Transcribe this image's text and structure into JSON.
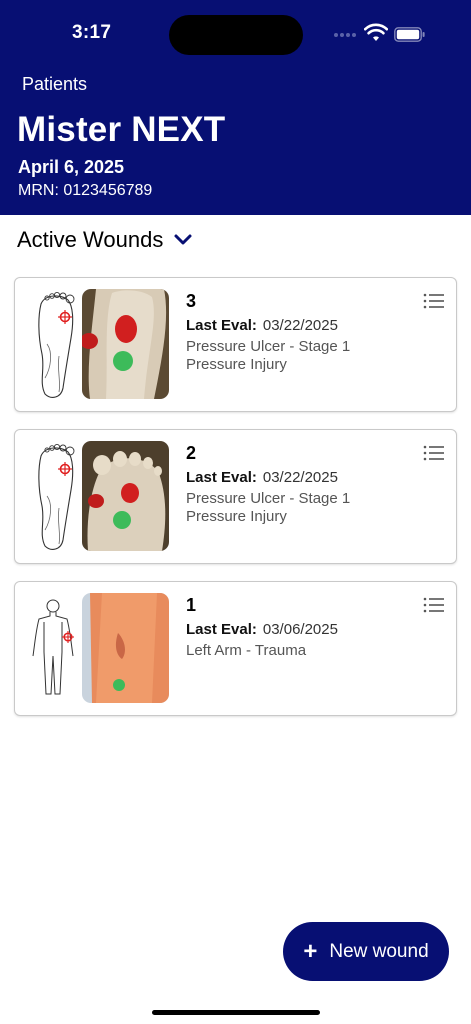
{
  "status_bar": {
    "time": "3:17",
    "icons": [
      "cellular-signal-icon",
      "wifi-icon",
      "battery-icon"
    ]
  },
  "header": {
    "back_label": "Patients",
    "patient_name": "Mister NEXT",
    "date": "April 6, 2025",
    "mrn": "MRN: 0123456789"
  },
  "section": {
    "title": "Active Wounds",
    "toggle_icon": "chevron-down-icon"
  },
  "wounds": [
    {
      "number": "3",
      "eval_label": "Last Eval:",
      "eval_date": "03/22/2025",
      "line1": "Pressure Ulcer - Stage 1",
      "line2": "Pressure Injury",
      "diagram": "foot-sole-diagram",
      "menu_icon": "list-menu-icon"
    },
    {
      "number": "2",
      "eval_label": "Last Eval:",
      "eval_date": "03/22/2025",
      "line1": "Pressure Ulcer - Stage 1",
      "line2": "Pressure Injury",
      "diagram": "foot-sole-diagram",
      "menu_icon": "list-menu-icon"
    },
    {
      "number": "1",
      "eval_label": "Last Eval:",
      "eval_date": "03/06/2025",
      "line1": "Left Arm - Trauma",
      "diagram": "body-diagram",
      "menu_icon": "list-menu-icon"
    }
  ],
  "fab": {
    "icon": "+",
    "label": "New wound"
  },
  "colors": {
    "primary": "#070f73",
    "marker_red": "#e02020",
    "marker_green": "#3dbb5a"
  }
}
